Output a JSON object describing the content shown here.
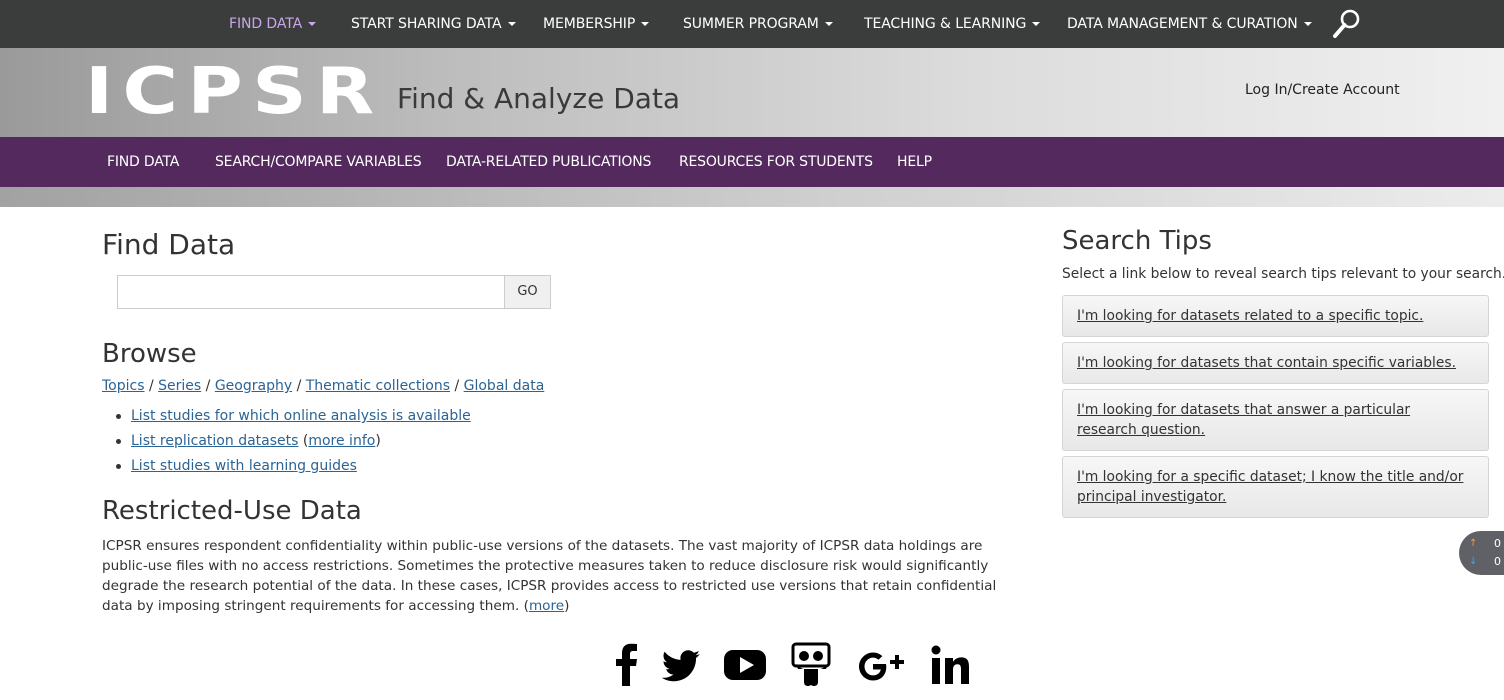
{
  "top_nav": {
    "items": [
      {
        "label": "FIND DATA",
        "active": true
      },
      {
        "label": "START SHARING DATA"
      },
      {
        "label": "MEMBERSHIP"
      },
      {
        "label": "SUMMER PROGRAM"
      },
      {
        "label": "TEACHING & LEARNING"
      },
      {
        "label": "DATA MANAGEMENT & CURATION"
      }
    ],
    "search_icon": "search-icon"
  },
  "banner": {
    "logo": "ICPSR",
    "site_title": "Find & Analyze Data",
    "login_label": "Log In/Create Account"
  },
  "sub_nav": {
    "items": [
      {
        "label": "FIND DATA"
      },
      {
        "label": "SEARCH/COMPARE VARIABLES"
      },
      {
        "label": "DATA-RELATED PUBLICATIONS"
      },
      {
        "label": "RESOURCES FOR STUDENTS"
      },
      {
        "label": "HELP"
      }
    ]
  },
  "main": {
    "title": "Find Data",
    "search": {
      "value": "",
      "placeholder": "",
      "go_label": "GO"
    },
    "browse": {
      "title": "Browse",
      "links": [
        "Topics",
        "Series",
        "Geography",
        "Thematic collections",
        "Global data"
      ],
      "separator": "/",
      "list": [
        {
          "label": "List studies for which online analysis is available"
        },
        {
          "label": "List replication datasets",
          "extra_open": "(",
          "extra": "more info",
          "extra_close": ")"
        },
        {
          "label": "List studies with learning guides"
        }
      ]
    },
    "restricted": {
      "title": "Restricted-Use Data",
      "text": "ICPSR ensures respondent confidentiality within public-use versions of the datasets. The vast majority of ICPSR data holdings are public-use files with no access restrictions. Sometimes the protective measures taken to reduce disclosure risk would significantly degrade the research potential of the data. In these cases, ICPSR provides access to restricted use versions that retain confidential data by imposing stringent requirements for accessing them.",
      "more_open": "(",
      "more_label": "more",
      "more_close": ")"
    }
  },
  "sidebar": {
    "title": "Search Tips",
    "intro": "Select a link below to reveal search tips relevant to your search.",
    "tips": [
      "I'm looking for datasets related to a specific topic.",
      "I'm looking for datasets that contain specific variables.",
      "I'm looking for datasets that answer a particular research question.",
      "I'm looking for a specific dataset; I know the title and/or principal investigator."
    ]
  },
  "widget": {
    "up_count": "0",
    "down_count": "0"
  },
  "social": [
    "facebook-icon",
    "twitter-icon",
    "youtube-icon",
    "slideshare-icon",
    "google-plus-icon",
    "linkedin-icon"
  ],
  "colors": {
    "top_nav_bg": "#3a3d3b",
    "sub_nav_bg": "#542a5e",
    "active_nav": "#c9a6ea",
    "link": "#2a6496"
  }
}
